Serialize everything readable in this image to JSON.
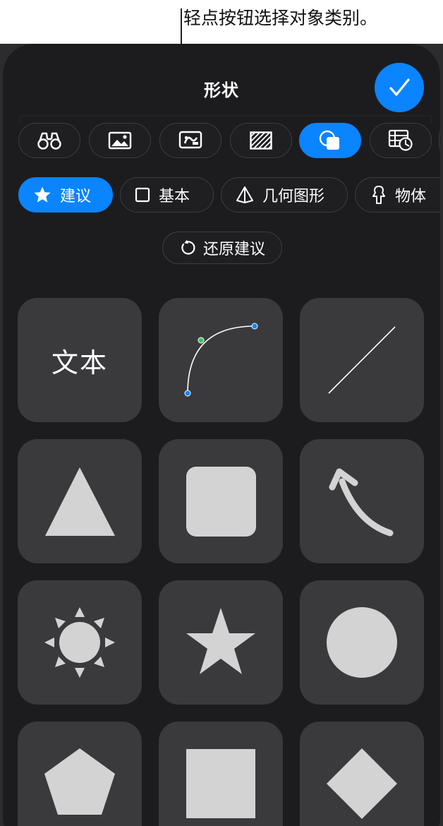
{
  "callout": {
    "text": "轻点按钮选择对象类别。"
  },
  "header": {
    "title": "形状",
    "done_icon": "checkmark-icon"
  },
  "categories": [
    {
      "name": "binoculars-icon",
      "active": false
    },
    {
      "name": "photo-icon",
      "active": false
    },
    {
      "name": "media-icon",
      "active": false
    },
    {
      "name": "hatched-square-icon",
      "active": false
    },
    {
      "name": "shapes-icon",
      "active": true
    },
    {
      "name": "chart-icon",
      "active": false
    }
  ],
  "subcategories": [
    {
      "label": "建议",
      "icon": "star-icon",
      "active": true
    },
    {
      "label": "基本",
      "icon": "square-icon",
      "active": false
    },
    {
      "label": "几何图形",
      "icon": "pyramid-icon",
      "active": false
    },
    {
      "label": "物体",
      "icon": "object-icon",
      "active": false
    }
  ],
  "restore": {
    "label": "还原建议",
    "icon": "restore-icon"
  },
  "tiles": [
    {
      "name": "text-shape",
      "label": "文本"
    },
    {
      "name": "curve-shape"
    },
    {
      "name": "line-shape"
    },
    {
      "name": "triangle-shape"
    },
    {
      "name": "rounded-square-shape"
    },
    {
      "name": "curved-arrow-shape"
    },
    {
      "name": "sun-shape"
    },
    {
      "name": "star-shape"
    },
    {
      "name": "circle-shape"
    },
    {
      "name": "pentagon-shape"
    },
    {
      "name": "square-shape"
    },
    {
      "name": "diamond-shape"
    }
  ],
  "colors": {
    "accent": "#0a84ff",
    "tile": "#3a3a3c",
    "shape": "#d3d3d3",
    "background": "#1c1c1e"
  }
}
